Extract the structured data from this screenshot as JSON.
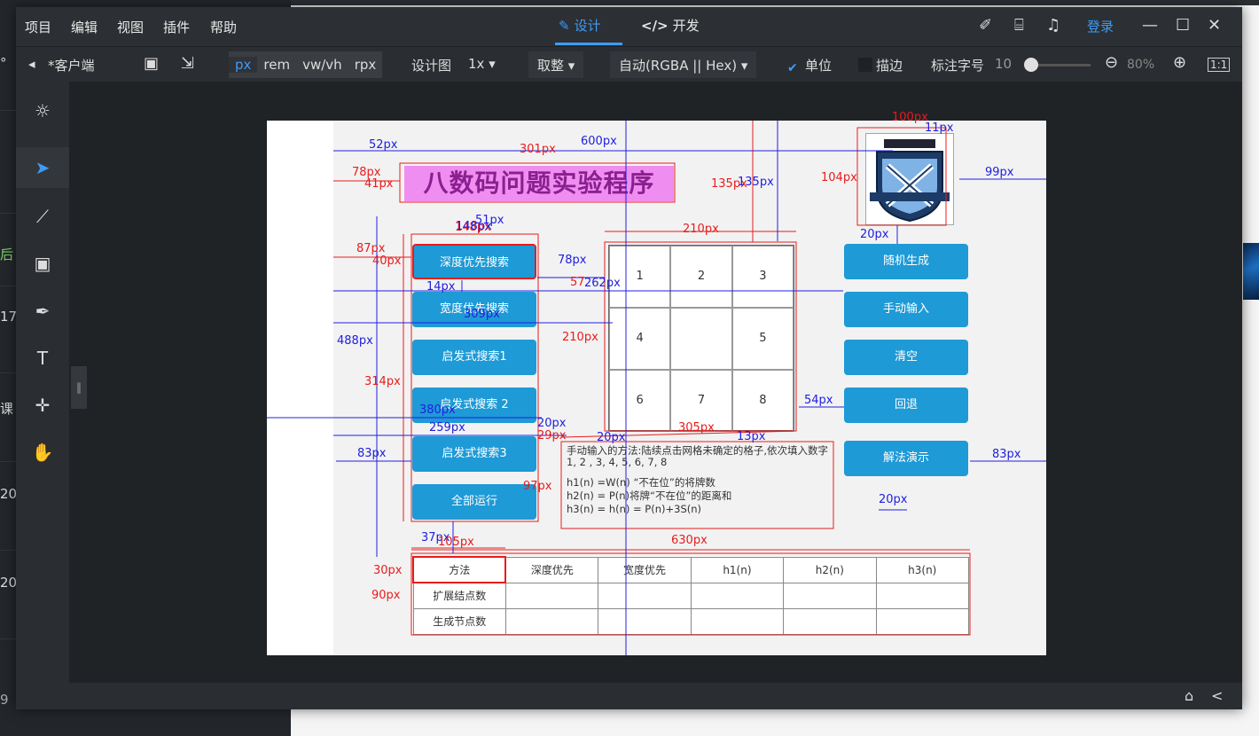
{
  "menubar": {
    "items": [
      "项目",
      "编辑",
      "视图",
      "插件",
      "帮助"
    ],
    "mode_tabs": [
      {
        "label": "设计",
        "active": true
      },
      {
        "label": "开发",
        "active": false
      }
    ],
    "login": "登录"
  },
  "toolbar": {
    "back_label": "*客户端",
    "units": [
      "px",
      "rem",
      "vw/vh",
      "rpx"
    ],
    "selected_unit": "px",
    "design_label": "设计图",
    "scale": "1x",
    "rounding": "取整",
    "color_format": "自动(RGBA || Hex)",
    "unit_label": "单位",
    "unit_checked": true,
    "stroke_label": "描边",
    "stroke_checked": false,
    "font_label": "标注字号",
    "font_value": "10",
    "zoom": "80%"
  },
  "background_fragments": [
    "°",
    "后 F",
    "17",
    "课",
    "20",
    "20",
    "9"
  ],
  "app": {
    "title": "八数码问题实验程序",
    "left_buttons": [
      "深度优先搜索",
      "宽度优先搜索",
      "启发式搜索1",
      "启发式搜索 2",
      "启发式搜索3",
      "全部运行"
    ],
    "right_buttons": [
      "随机生成",
      "手动输入",
      "清空",
      "回退",
      "解法演示"
    ],
    "grid": [
      "1",
      "2",
      "3",
      "4",
      "",
      "5",
      "6",
      "7",
      "8"
    ],
    "instructions": [
      "手动输入的方法:陆续点击网格未确定的格子,依次填入数字1, 2 , 3, 4, 5, 6, 7, 8",
      "h1(n) =W(n) “不在位”的将牌数",
      "h2(n) = P(n)将牌“不在位”的距离和",
      "h3(n) = h(n) = P(n)+3S(n)"
    ],
    "table": {
      "headers": [
        "方法",
        "深度优先",
        "宽度优先",
        "h1(n)",
        "h2(n)",
        "h3(n)"
      ],
      "rows": [
        [
          "扩展结点数",
          "",
          "",
          "",
          "",
          ""
        ],
        [
          "生成节点数",
          "",
          "",
          "",
          "",
          ""
        ]
      ]
    }
  },
  "measurements": {
    "red": [
      "100px",
      "301px",
      "78px",
      "41px",
      "135px",
      "104px",
      "148px",
      "87px",
      "40px",
      "210px",
      "210px",
      "57",
      "314px",
      "305px",
      "29px",
      "97px",
      "105px",
      "630px",
      "30px",
      "90px"
    ],
    "blue": [
      "11px",
      "52px",
      "600px",
      "135px",
      "99px",
      "51px",
      "148px",
      "20px",
      "78px",
      "14px",
      "262px",
      "309px",
      "488px",
      "380px",
      "259px",
      "20px",
      "20px",
      "13px",
      "54px",
      "83px",
      "83px",
      "20px",
      "37px"
    ]
  }
}
